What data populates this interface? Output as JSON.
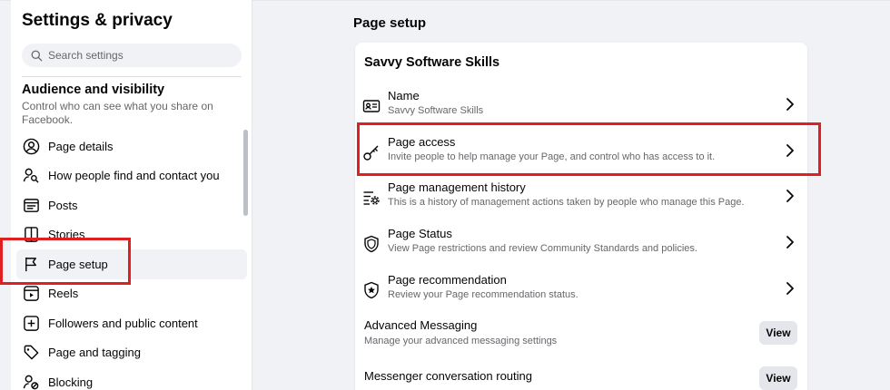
{
  "sidebar": {
    "title": "Settings & privacy",
    "search_placeholder": "Search settings",
    "section_title": "Audience and visibility",
    "section_desc": "Control who can see what you share on Facebook.",
    "items": [
      {
        "label": "Page details",
        "icon": "person-circle-icon"
      },
      {
        "label": "How people find and contact you",
        "icon": "person-search-icon"
      },
      {
        "label": "Posts",
        "icon": "posts-icon"
      },
      {
        "label": "Stories",
        "icon": "book-icon"
      },
      {
        "label": "Page setup",
        "icon": "flag-icon",
        "active": true
      },
      {
        "label": "Reels",
        "icon": "reels-icon"
      },
      {
        "label": "Followers and public content",
        "icon": "plus-square-icon"
      },
      {
        "label": "Page and tagging",
        "icon": "tag-icon"
      },
      {
        "label": "Blocking",
        "icon": "person-block-icon"
      }
    ]
  },
  "main": {
    "title": "Page setup",
    "card_title": "Savvy Software Skills",
    "rows": [
      {
        "title": "Name",
        "desc": "Savvy Software Skills",
        "icon": "id-card-icon"
      },
      {
        "title": "Page access",
        "desc": "Invite people to help manage your Page, and control who has access to it.",
        "icon": "key-icon"
      },
      {
        "title": "Page management history",
        "desc": "This is a history of management actions taken by people who manage this Page.",
        "icon": "list-gear-icon"
      },
      {
        "title": "Page Status",
        "desc": "View Page restrictions and review Community Standards and policies.",
        "icon": "shield-icon"
      },
      {
        "title": "Page recommendation",
        "desc": "Review your Page recommendation status.",
        "icon": "star-shield-icon"
      }
    ],
    "advanced_messaging": {
      "title": "Advanced Messaging",
      "desc": "Manage your advanced messaging settings",
      "button": "View"
    },
    "messenger_routing": {
      "title": "Messenger conversation routing",
      "button": "View"
    }
  },
  "colors": {
    "highlight": "#e02020",
    "secondary_text": "#65676b",
    "background": "#f0f2f5"
  }
}
